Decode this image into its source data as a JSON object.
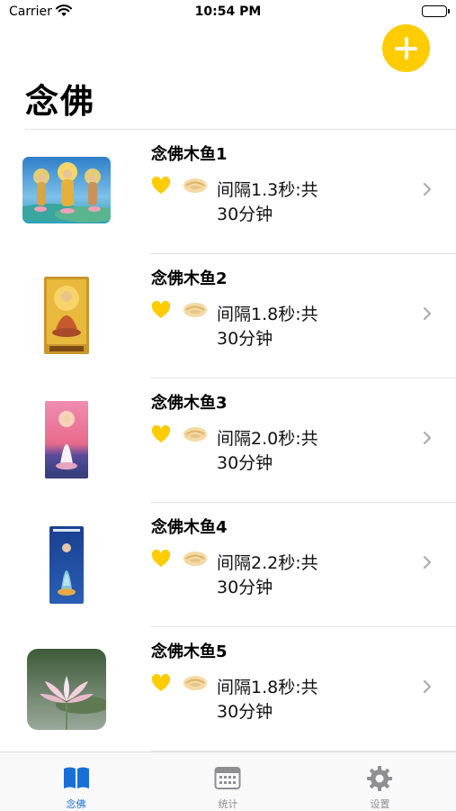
{
  "status_bar": {
    "carrier": "Carrier",
    "time": "10:54 PM"
  },
  "page": {
    "title": "念佛"
  },
  "colors": {
    "accent": "#FFCC00",
    "tab_active": "#1a6fd6",
    "tab_inactive": "#8e8e93"
  },
  "items": [
    {
      "title": "念佛木鱼1",
      "desc": "间隔1.3秒:共30分钟",
      "image": "three-buddhas-painting"
    },
    {
      "title": "念佛木鱼2",
      "desc": "间隔1.8秒:共30分钟",
      "image": "seated-buddha-golden"
    },
    {
      "title": "念佛木鱼3",
      "desc": "间隔2.0秒:共30分钟",
      "image": "guanyin-sunset"
    },
    {
      "title": "念佛木鱼4",
      "desc": "间隔2.2秒:共30分钟",
      "image": "guanyin-blue"
    },
    {
      "title": "念佛木鱼5",
      "desc": "间隔1.8秒:共30分钟",
      "image": "lotus-flower-photo"
    }
  ],
  "tabs": [
    {
      "label": "念佛",
      "icon": "book-icon",
      "active": true
    },
    {
      "label": "统计",
      "icon": "calendar-icon",
      "active": false
    },
    {
      "label": "设置",
      "icon": "gear-icon",
      "active": false
    }
  ]
}
